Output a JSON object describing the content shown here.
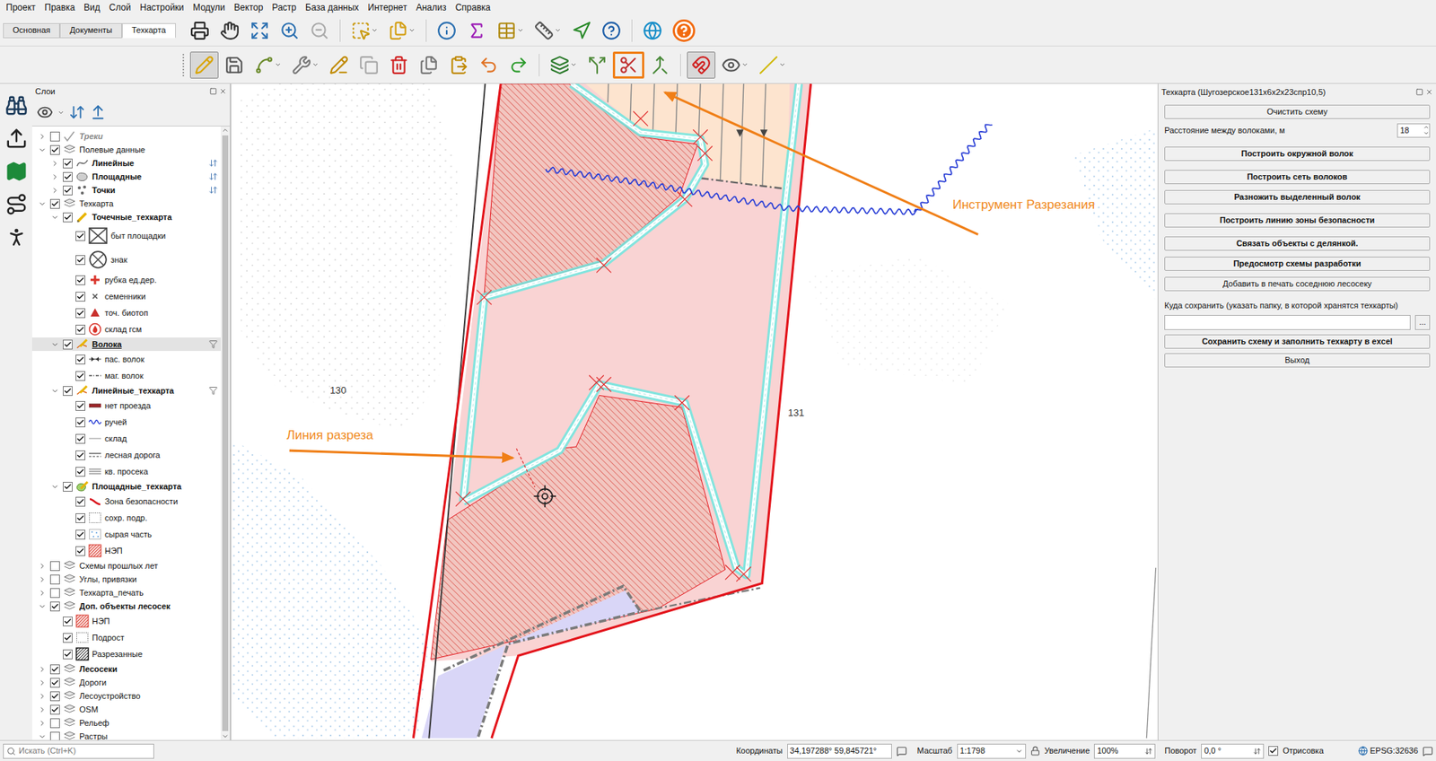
{
  "menu": [
    "Проект",
    "Правка",
    "Вид",
    "Слой",
    "Настройки",
    "Модули",
    "Вектор",
    "Растр",
    "База данных",
    "Интернет",
    "Анализ",
    "Справка"
  ],
  "tabs": [
    {
      "label": "Основная",
      "selected": false
    },
    {
      "label": "Документы",
      "selected": false
    },
    {
      "label": "Техкарта",
      "selected": true
    }
  ],
  "edit_toolbar": [
    {
      "selected": true,
      "highlighted": false
    },
    {
      "selected": false,
      "highlighted": false
    },
    {
      "selected": false,
      "highlighted": false
    },
    {
      "selected": false,
      "highlighted": false
    },
    {
      "selected": false,
      "highlighted": false
    },
    {
      "selected": false,
      "highlighted": false
    },
    {
      "selected": false,
      "highlighted": false
    },
    {
      "selected": false,
      "highlighted": false
    },
    {
      "selected": false,
      "highlighted": false
    },
    {
      "selected": false,
      "highlighted": false
    },
    {
      "selected": false,
      "highlighted": false
    },
    {
      "selected": false,
      "highlighted": false
    },
    {
      "selected": false,
      "highlighted": false
    },
    {
      "selected": false,
      "highlighted": true
    },
    {
      "selected": false,
      "highlighted": false
    },
    {
      "selected": true,
      "highlighted": false
    },
    {
      "selected": false,
      "highlighted": false
    },
    {
      "selected": false,
      "highlighted": false
    }
  ],
  "layers_panel": {
    "title": "Слои",
    "items": [
      {
        "label": "Треки",
        "kind": "layer",
        "level": 0,
        "checked": false,
        "expanded": false,
        "selected": false,
        "bold": true,
        "greyed": true,
        "linked": false,
        "filtered": false
      },
      {
        "label": "Полевые данные",
        "kind": "group",
        "level": 0,
        "checked": true,
        "expanded": true,
        "selected": false,
        "bold": false,
        "greyed": false,
        "linked": false,
        "filtered": false
      },
      {
        "label": "Линейные",
        "kind": "layer",
        "level": 1,
        "checked": true,
        "expanded": false,
        "selected": false,
        "bold": true,
        "greyed": false,
        "linked": true,
        "filtered": false
      },
      {
        "label": "Площадные",
        "kind": "layer",
        "level": 1,
        "checked": true,
        "expanded": false,
        "selected": false,
        "bold": true,
        "greyed": false,
        "linked": true,
        "filtered": false
      },
      {
        "label": "Точки",
        "kind": "layer",
        "level": 1,
        "checked": true,
        "expanded": false,
        "selected": false,
        "bold": true,
        "greyed": false,
        "linked": true,
        "filtered": false
      },
      {
        "label": "Техкарта",
        "kind": "group",
        "level": 0,
        "checked": true,
        "expanded": true,
        "selected": false,
        "bold": false,
        "greyed": false,
        "linked": false,
        "filtered": false
      },
      {
        "label": "Точечные_техкарта",
        "kind": "layer",
        "level": 1,
        "checked": true,
        "expanded": true,
        "selected": false,
        "bold": true,
        "greyed": false,
        "linked": false,
        "filtered": false
      },
      {
        "label": "быт площадки",
        "kind": "legend",
        "level": 2,
        "checked": true,
        "selected": false,
        "bold": false,
        "greyed": false,
        "linked": false,
        "filtered": false
      },
      {
        "label": "знак",
        "kind": "legend",
        "level": 2,
        "checked": true,
        "selected": false,
        "bold": false,
        "greyed": false,
        "linked": false,
        "filtered": false
      },
      {
        "label": "рубка ед.дер.",
        "kind": "legend",
        "level": 2,
        "checked": true,
        "selected": false,
        "bold": false,
        "greyed": false,
        "linked": false,
        "filtered": false
      },
      {
        "label": "семенники",
        "kind": "legend",
        "level": 2,
        "checked": true,
        "selected": false,
        "bold": false,
        "greyed": false,
        "linked": false,
        "filtered": false
      },
      {
        "label": "точ. биотоп",
        "kind": "legend",
        "level": 2,
        "checked": true,
        "selected": false,
        "bold": false,
        "greyed": false,
        "linked": false,
        "filtered": false
      },
      {
        "label": "склад гсм",
        "kind": "legend",
        "level": 2,
        "checked": true,
        "selected": false,
        "bold": false,
        "greyed": false,
        "linked": false,
        "filtered": false
      },
      {
        "label": "Волока",
        "kind": "layer",
        "level": 1,
        "checked": true,
        "expanded": true,
        "selected": true,
        "bold": true,
        "greyed": false,
        "linked": false,
        "filtered": true
      },
      {
        "label": "пас. волок",
        "kind": "legend",
        "level": 2,
        "checked": true,
        "selected": false,
        "bold": false,
        "greyed": false,
        "linked": false,
        "filtered": false
      },
      {
        "label": "маг. волок",
        "kind": "legend",
        "level": 2,
        "checked": true,
        "selected": false,
        "bold": false,
        "greyed": false,
        "linked": false,
        "filtered": false
      },
      {
        "label": "Линейные_техкарта",
        "kind": "layer",
        "level": 1,
        "checked": true,
        "expanded": true,
        "selected": false,
        "bold": true,
        "greyed": false,
        "linked": false,
        "filtered": true
      },
      {
        "label": "нет проезда",
        "kind": "legend",
        "level": 2,
        "checked": true,
        "selected": false,
        "bold": false,
        "greyed": false,
        "linked": false,
        "filtered": false
      },
      {
        "label": "ручей",
        "kind": "legend",
        "level": 2,
        "checked": true,
        "selected": false,
        "bold": false,
        "greyed": false,
        "linked": false,
        "filtered": false
      },
      {
        "label": "склад",
        "kind": "legend",
        "level": 2,
        "checked": true,
        "selected": false,
        "bold": false,
        "greyed": false,
        "linked": false,
        "filtered": false
      },
      {
        "label": "лесная дорога",
        "kind": "legend",
        "level": 2,
        "checked": true,
        "selected": false,
        "bold": false,
        "greyed": false,
        "linked": false,
        "filtered": false
      },
      {
        "label": "кв. просека",
        "kind": "legend",
        "level": 2,
        "checked": true,
        "selected": false,
        "bold": false,
        "greyed": false,
        "linked": false,
        "filtered": false
      },
      {
        "label": "Площадные_техкарта",
        "kind": "layer",
        "level": 1,
        "checked": true,
        "expanded": true,
        "selected": false,
        "bold": true,
        "greyed": false,
        "linked": false,
        "filtered": false
      },
      {
        "label": "Зона безопасности",
        "kind": "legend",
        "level": 2,
        "checked": true,
        "selected": false,
        "bold": false,
        "greyed": false,
        "linked": false,
        "filtered": false
      },
      {
        "label": "сохр. подр.",
        "kind": "legend",
        "level": 2,
        "checked": true,
        "selected": false,
        "bold": false,
        "greyed": false,
        "linked": false,
        "filtered": false
      },
      {
        "label": "сырая часть",
        "kind": "legend",
        "level": 2,
        "checked": true,
        "selected": false,
        "bold": false,
        "greyed": false,
        "linked": false,
        "filtered": false
      },
      {
        "label": "НЭП",
        "kind": "legend",
        "level": 2,
        "checked": true,
        "selected": false,
        "bold": false,
        "greyed": false,
        "linked": false,
        "filtered": false
      },
      {
        "label": "Схемы прошлых лет",
        "kind": "group",
        "level": 0,
        "checked": false,
        "expanded": false,
        "selected": false,
        "bold": false,
        "greyed": false,
        "linked": false,
        "filtered": false
      },
      {
        "label": "Углы, привязки",
        "kind": "group",
        "level": 0,
        "checked": false,
        "expanded": false,
        "selected": false,
        "bold": false,
        "greyed": false,
        "linked": false,
        "filtered": false
      },
      {
        "label": "Техкарта_печать",
        "kind": "group",
        "level": 0,
        "checked": false,
        "expanded": false,
        "selected": false,
        "bold": false,
        "greyed": false,
        "linked": false,
        "filtered": false
      },
      {
        "label": "Доп. объекты лесосек",
        "kind": "group",
        "level": 0,
        "checked": true,
        "expanded": true,
        "selected": false,
        "bold": true,
        "greyed": false,
        "linked": false,
        "filtered": false
      },
      {
        "label": "НЭП",
        "kind": "legend",
        "level": 1,
        "checked": true,
        "selected": false,
        "bold": false,
        "greyed": false,
        "linked": false,
        "filtered": false
      },
      {
        "label": "Подрост",
        "kind": "legend",
        "level": 1,
        "checked": true,
        "selected": false,
        "bold": false,
        "greyed": false,
        "linked": false,
        "filtered": false
      },
      {
        "label": "Разрезанные",
        "kind": "legend",
        "level": 1,
        "checked": true,
        "selected": false,
        "bold": false,
        "greyed": false,
        "linked": false,
        "filtered": false
      },
      {
        "label": "Лесосеки",
        "kind": "group",
        "level": 0,
        "checked": true,
        "expanded": false,
        "selected": false,
        "bold": true,
        "greyed": false,
        "linked": false,
        "filtered": false
      },
      {
        "label": "Дороги",
        "kind": "group",
        "level": 0,
        "checked": true,
        "expanded": false,
        "selected": false,
        "bold": false,
        "greyed": false,
        "linked": false,
        "filtered": false
      },
      {
        "label": "Лесоустройство",
        "kind": "group",
        "level": 0,
        "checked": true,
        "expanded": false,
        "selected": false,
        "bold": false,
        "greyed": false,
        "linked": false,
        "filtered": false
      },
      {
        "label": "OSM",
        "kind": "group",
        "level": 0,
        "checked": true,
        "expanded": false,
        "selected": false,
        "bold": false,
        "greyed": false,
        "linked": false,
        "filtered": false
      },
      {
        "label": "Рельеф",
        "kind": "group",
        "level": 0,
        "checked": false,
        "expanded": false,
        "selected": false,
        "bold": false,
        "greyed": false,
        "linked": false,
        "filtered": false
      },
      {
        "label": "Растры",
        "kind": "group",
        "level": 0,
        "checked": false,
        "expanded": true,
        "selected": false,
        "bold": false,
        "greyed": false,
        "linked": false,
        "filtered": false
      }
    ]
  },
  "map": {
    "quarter_labels": [
      "130",
      "131"
    ]
  },
  "annotations": [
    {
      "text": "Инструмент Разрезания"
    },
    {
      "text": "Линия разреза"
    }
  ],
  "plugin_panel": {
    "title": "Техкарта (Шугозерское131х6х2х23спр10,5)",
    "clear_button": "Очистить схему",
    "spacing_label": "Расстояние между волоками, м",
    "spacing_value": "18",
    "groups": [
      [
        {
          "label": "Построить окружной волок",
          "bold": true
        }
      ],
      [
        {
          "label": "Построить сеть волоков",
          "bold": true
        },
        {
          "label": "Разножить выделенный волок",
          "bold": true
        }
      ],
      [
        {
          "label": "Построить линию зоны безопасности",
          "bold": true
        }
      ],
      [
        {
          "label": "Связать объекты с делянкой.",
          "bold": true
        },
        {
          "label": "Предосмотр схемы разработки",
          "bold": true
        },
        {
          "label": "Добавить в печать соседнюю лесосеку",
          "bold": false
        }
      ]
    ],
    "save_label": "Куда сохранить (указать папку, в которой хранятся техкарты)",
    "save_path": "",
    "browse_button": "...",
    "final_buttons": [
      {
        "label": "Сохранить схему и заполнить техкарту в excel",
        "bold": true
      },
      {
        "label": "Выход",
        "bold": false
      }
    ]
  },
  "status_bar": {
    "search_placeholder": "Искать (Ctrl+K)",
    "coordinates_label": "Координаты",
    "coordinates": "34,197288° 59,845721°",
    "scale_label": "Масштаб",
    "scale": "1:1798",
    "magnifier_label": "Увеличение",
    "magnifier": "100%",
    "rotation_label": "Поворот",
    "rotation": "0,0 °",
    "render_label": "Отрисовка",
    "render_checked": true,
    "crs": "EPSG:32636"
  }
}
